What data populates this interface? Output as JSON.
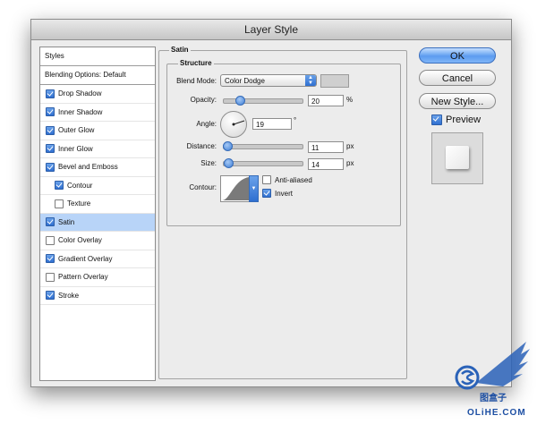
{
  "window": {
    "title": "Layer Style"
  },
  "sidebar": {
    "header": "Styles",
    "blending": "Blending Options: Default",
    "items": [
      {
        "label": "Drop Shadow",
        "checked": true,
        "sub": false,
        "selected": false
      },
      {
        "label": "Inner Shadow",
        "checked": true,
        "sub": false,
        "selected": false
      },
      {
        "label": "Outer Glow",
        "checked": true,
        "sub": false,
        "selected": false
      },
      {
        "label": "Inner Glow",
        "checked": true,
        "sub": false,
        "selected": false
      },
      {
        "label": "Bevel and Emboss",
        "checked": true,
        "sub": false,
        "selected": false
      },
      {
        "label": "Contour",
        "checked": true,
        "sub": true,
        "selected": false
      },
      {
        "label": "Texture",
        "checked": false,
        "sub": true,
        "selected": false
      },
      {
        "label": "Satin",
        "checked": true,
        "sub": false,
        "selected": true
      },
      {
        "label": "Color Overlay",
        "checked": false,
        "sub": false,
        "selected": false
      },
      {
        "label": "Gradient Overlay",
        "checked": true,
        "sub": false,
        "selected": false
      },
      {
        "label": "Pattern Overlay",
        "checked": false,
        "sub": false,
        "selected": false
      },
      {
        "label": "Stroke",
        "checked": true,
        "sub": false,
        "selected": false
      }
    ]
  },
  "satin": {
    "group_label": "Satin",
    "structure_label": "Structure",
    "blend_mode_label": "Blend Mode:",
    "blend_mode_value": "Color Dodge",
    "blend_color": "#cfcfcf",
    "opacity_label": "Opacity:",
    "opacity_value": "20",
    "opacity_unit": "%",
    "opacity_fraction": 0.2,
    "angle_label": "Angle:",
    "angle_value": "19",
    "angle_unit": "°",
    "distance_label": "Distance:",
    "distance_value": "11",
    "distance_unit": "px",
    "distance_fraction": 0.045,
    "size_label": "Size:",
    "size_value": "14",
    "size_unit": "px",
    "size_fraction": 0.055,
    "contour_label": "Contour:",
    "anti_aliased_label": "Anti-aliased",
    "anti_aliased_checked": false,
    "invert_label": "Invert",
    "invert_checked": true
  },
  "buttons": {
    "ok": "OK",
    "cancel": "Cancel",
    "new_style": "New Style...",
    "preview": "Preview",
    "preview_checked": true
  },
  "watermark": {
    "text": "图盒子",
    "url": "OLiHE.COM"
  }
}
